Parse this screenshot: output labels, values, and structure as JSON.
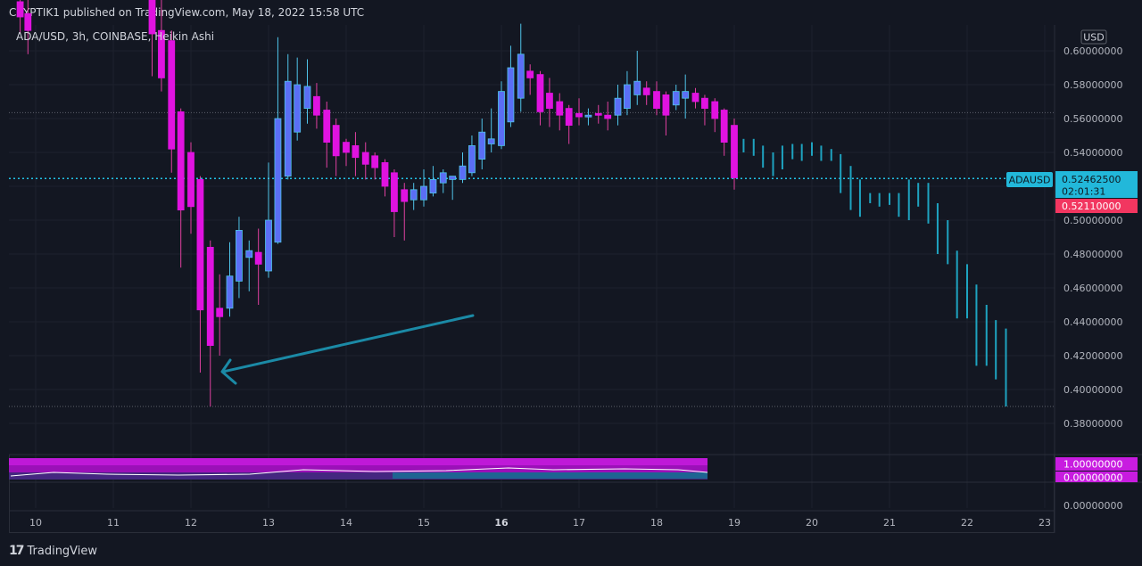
{
  "header": {
    "published": "CRYPTIK1 published on TradingView.com, May 18, 2022 15:58 UTC",
    "legend": "ADA/USD, 3h, COINBASE, Heikin Ashi"
  },
  "axis": {
    "currency": "USD",
    "price_ticks": [
      "0.60000000",
      "0.58000000",
      "0.56000000",
      "0.54000000",
      "0.52000000",
      "0.50000000",
      "0.48000000",
      "0.46000000",
      "0.44000000",
      "0.42000000",
      "0.40000000",
      "0.38000000"
    ],
    "osc_ticks": [
      "1.00000000",
      "0.00000000"
    ],
    "zero_tick": "0.00000000",
    "x_ticks": [
      "10",
      "11",
      "12",
      "13",
      "14",
      "15",
      "16",
      "17",
      "18",
      "19",
      "20",
      "21",
      "22",
      "23"
    ]
  },
  "tags": {
    "symbol": "ADAUSD",
    "last_price": "0.52462500",
    "countdown": "02:01:31",
    "second_price": "0.52110000"
  },
  "colors": {
    "background": "#131722",
    "bull": "#5b6ef5",
    "bear": "#e013e0",
    "projection": "#1ea3c0",
    "last_price_line": "#22c3e6",
    "second_tag": "#f23660"
  },
  "brand": {
    "label": "TradingView",
    "logo": "tradingview-logo-icon"
  },
  "chart_data": {
    "type": "candlestick",
    "style": "Heikin Ashi",
    "symbol": "ADA/USD",
    "interval": "3h",
    "exchange": "COINBASE",
    "ylim": [
      0.37,
      0.63
    ],
    "last_price": 0.524625,
    "dotted_levels": [
      0.5635,
      0.39
    ],
    "candles": [
      {
        "x": 9.8,
        "o": 0.629,
        "c": 0.62,
        "h": 0.634,
        "l": 0.61
      },
      {
        "x": 9.9,
        "o": 0.622,
        "c": 0.612,
        "h": 0.63,
        "l": 0.598
      },
      {
        "x": 11.5,
        "o": 0.635,
        "c": 0.61,
        "h": 0.642,
        "l": 0.585
      },
      {
        "x": 11.62,
        "o": 0.612,
        "c": 0.584,
        "h": 0.63,
        "l": 0.576
      },
      {
        "x": 11.75,
        "o": 0.606,
        "c": 0.542,
        "h": 0.612,
        "l": 0.528
      },
      {
        "x": 11.87,
        "o": 0.564,
        "c": 0.506,
        "h": 0.566,
        "l": 0.472
      },
      {
        "x": 12.0,
        "o": 0.54,
        "c": 0.508,
        "h": 0.546,
        "l": 0.492
      },
      {
        "x": 12.12,
        "o": 0.524,
        "c": 0.447,
        "h": 0.526,
        "l": 0.41
      },
      {
        "x": 12.25,
        "o": 0.484,
        "c": 0.426,
        "h": 0.488,
        "l": 0.39
      },
      {
        "x": 12.37,
        "o": 0.448,
        "c": 0.443,
        "h": 0.468,
        "l": 0.42
      },
      {
        "x": 12.5,
        "o": 0.448,
        "c": 0.467,
        "h": 0.487,
        "l": 0.443
      },
      {
        "x": 12.62,
        "o": 0.464,
        "c": 0.494,
        "h": 0.502,
        "l": 0.454
      },
      {
        "x": 12.75,
        "o": 0.478,
        "c": 0.482,
        "h": 0.488,
        "l": 0.458
      },
      {
        "x": 12.87,
        "o": 0.481,
        "c": 0.474,
        "h": 0.495,
        "l": 0.45
      },
      {
        "x": 13.0,
        "o": 0.47,
        "c": 0.5,
        "h": 0.534,
        "l": 0.466
      },
      {
        "x": 13.12,
        "o": 0.487,
        "c": 0.56,
        "h": 0.608,
        "l": 0.486
      },
      {
        "x": 13.25,
        "o": 0.526,
        "c": 0.582,
        "h": 0.598,
        "l": 0.524
      },
      {
        "x": 13.37,
        "o": 0.552,
        "c": 0.58,
        "h": 0.596,
        "l": 0.547
      },
      {
        "x": 13.5,
        "o": 0.566,
        "c": 0.579,
        "h": 0.595,
        "l": 0.557
      },
      {
        "x": 13.62,
        "o": 0.573,
        "c": 0.562,
        "h": 0.581,
        "l": 0.554
      },
      {
        "x": 13.75,
        "o": 0.565,
        "c": 0.546,
        "h": 0.57,
        "l": 0.531
      },
      {
        "x": 13.87,
        "o": 0.556,
        "c": 0.538,
        "h": 0.56,
        "l": 0.526
      },
      {
        "x": 14.0,
        "o": 0.546,
        "c": 0.54,
        "h": 0.548,
        "l": 0.532
      },
      {
        "x": 14.12,
        "o": 0.544,
        "c": 0.537,
        "h": 0.552,
        "l": 0.526
      },
      {
        "x": 14.25,
        "o": 0.54,
        "c": 0.533,
        "h": 0.546,
        "l": 0.524
      },
      {
        "x": 14.37,
        "o": 0.538,
        "c": 0.531,
        "h": 0.54,
        "l": 0.524
      },
      {
        "x": 14.5,
        "o": 0.534,
        "c": 0.52,
        "h": 0.536,
        "l": 0.514
      },
      {
        "x": 14.62,
        "o": 0.528,
        "c": 0.505,
        "h": 0.53,
        "l": 0.49
      },
      {
        "x": 14.75,
        "o": 0.518,
        "c": 0.511,
        "h": 0.522,
        "l": 0.488
      },
      {
        "x": 14.87,
        "o": 0.512,
        "c": 0.518,
        "h": 0.522,
        "l": 0.506
      },
      {
        "x": 15.0,
        "o": 0.512,
        "c": 0.52,
        "h": 0.53,
        "l": 0.508
      },
      {
        "x": 15.12,
        "o": 0.516,
        "c": 0.524,
        "h": 0.532,
        "l": 0.514
      },
      {
        "x": 15.25,
        "o": 0.522,
        "c": 0.528,
        "h": 0.53,
        "l": 0.516
      },
      {
        "x": 15.37,
        "o": 0.524,
        "c": 0.526,
        "h": 0.526,
        "l": 0.512
      },
      {
        "x": 15.5,
        "o": 0.524,
        "c": 0.532,
        "h": 0.54,
        "l": 0.522
      },
      {
        "x": 15.62,
        "o": 0.528,
        "c": 0.544,
        "h": 0.55,
        "l": 0.526
      },
      {
        "x": 15.75,
        "o": 0.536,
        "c": 0.552,
        "h": 0.56,
        "l": 0.53
      },
      {
        "x": 15.87,
        "o": 0.545,
        "c": 0.548,
        "h": 0.566,
        "l": 0.54
      },
      {
        "x": 16.0,
        "o": 0.544,
        "c": 0.576,
        "h": 0.582,
        "l": 0.542
      },
      {
        "x": 16.12,
        "o": 0.558,
        "c": 0.59,
        "h": 0.603,
        "l": 0.555
      },
      {
        "x": 16.25,
        "o": 0.572,
        "c": 0.598,
        "h": 0.616,
        "l": 0.564
      },
      {
        "x": 16.37,
        "o": 0.588,
        "c": 0.584,
        "h": 0.592,
        "l": 0.574
      },
      {
        "x": 16.5,
        "o": 0.586,
        "c": 0.564,
        "h": 0.588,
        "l": 0.556
      },
      {
        "x": 16.62,
        "o": 0.575,
        "c": 0.566,
        "h": 0.584,
        "l": 0.555
      },
      {
        "x": 16.75,
        "o": 0.57,
        "c": 0.562,
        "h": 0.575,
        "l": 0.553
      },
      {
        "x": 16.87,
        "o": 0.566,
        "c": 0.556,
        "h": 0.568,
        "l": 0.545
      },
      {
        "x": 17.0,
        "o": 0.563,
        "c": 0.561,
        "h": 0.572,
        "l": 0.556
      },
      {
        "x": 17.12,
        "o": 0.561,
        "c": 0.562,
        "h": 0.566,
        "l": 0.556
      },
      {
        "x": 17.25,
        "o": 0.563,
        "c": 0.562,
        "h": 0.568,
        "l": 0.557
      },
      {
        "x": 17.37,
        "o": 0.562,
        "c": 0.56,
        "h": 0.57,
        "l": 0.553
      },
      {
        "x": 17.5,
        "o": 0.562,
        "c": 0.572,
        "h": 0.58,
        "l": 0.556
      },
      {
        "x": 17.62,
        "o": 0.566,
        "c": 0.58,
        "h": 0.588,
        "l": 0.562
      },
      {
        "x": 17.75,
        "o": 0.574,
        "c": 0.582,
        "h": 0.6,
        "l": 0.568
      },
      {
        "x": 17.87,
        "o": 0.578,
        "c": 0.574,
        "h": 0.582,
        "l": 0.568
      },
      {
        "x": 18.0,
        "o": 0.576,
        "c": 0.566,
        "h": 0.582,
        "l": 0.562
      },
      {
        "x": 18.12,
        "o": 0.574,
        "c": 0.562,
        "h": 0.576,
        "l": 0.55
      },
      {
        "x": 18.25,
        "o": 0.568,
        "c": 0.576,
        "h": 0.58,
        "l": 0.565
      },
      {
        "x": 18.37,
        "o": 0.572,
        "c": 0.576,
        "h": 0.586,
        "l": 0.56
      },
      {
        "x": 18.5,
        "o": 0.575,
        "c": 0.57,
        "h": 0.578,
        "l": 0.566
      },
      {
        "x": 18.62,
        "o": 0.572,
        "c": 0.566,
        "h": 0.574,
        "l": 0.556
      },
      {
        "x": 18.75,
        "o": 0.57,
        "c": 0.56,
        "h": 0.572,
        "l": 0.552
      },
      {
        "x": 18.87,
        "o": 0.565,
        "c": 0.546,
        "h": 0.566,
        "l": 0.538
      },
      {
        "x": 19.0,
        "o": 0.556,
        "c": 0.525,
        "h": 0.56,
        "l": 0.518
      }
    ],
    "projection": [
      {
        "x": 19.12,
        "h": 0.548,
        "l": 0.54
      },
      {
        "x": 19.25,
        "h": 0.548,
        "l": 0.538
      },
      {
        "x": 19.37,
        "h": 0.544,
        "l": 0.531
      },
      {
        "x": 19.5,
        "h": 0.54,
        "l": 0.526
      },
      {
        "x": 19.62,
        "h": 0.544,
        "l": 0.53
      },
      {
        "x": 19.75,
        "h": 0.545,
        "l": 0.536
      },
      {
        "x": 19.87,
        "h": 0.545,
        "l": 0.535
      },
      {
        "x": 20.0,
        "h": 0.546,
        "l": 0.538
      },
      {
        "x": 20.12,
        "h": 0.544,
        "l": 0.535
      },
      {
        "x": 20.25,
        "h": 0.542,
        "l": 0.535
      },
      {
        "x": 20.37,
        "h": 0.539,
        "l": 0.516
      },
      {
        "x": 20.5,
        "h": 0.532,
        "l": 0.506
      },
      {
        "x": 20.62,
        "h": 0.524,
        "l": 0.502
      },
      {
        "x": 20.75,
        "h": 0.516,
        "l": 0.51
      },
      {
        "x": 20.87,
        "h": 0.516,
        "l": 0.508
      },
      {
        "x": 21.0,
        "h": 0.516,
        "l": 0.509
      },
      {
        "x": 21.12,
        "h": 0.516,
        "l": 0.502
      },
      {
        "x": 21.25,
        "h": 0.524,
        "l": 0.5
      },
      {
        "x": 21.37,
        "h": 0.522,
        "l": 0.508
      },
      {
        "x": 21.5,
        "h": 0.522,
        "l": 0.498
      },
      {
        "x": 21.62,
        "h": 0.51,
        "l": 0.48
      },
      {
        "x": 21.75,
        "h": 0.5,
        "l": 0.474
      },
      {
        "x": 21.87,
        "h": 0.482,
        "l": 0.442
      },
      {
        "x": 22.0,
        "h": 0.474,
        "l": 0.442
      },
      {
        "x": 22.12,
        "h": 0.462,
        "l": 0.414
      },
      {
        "x": 22.25,
        "h": 0.45,
        "l": 0.414
      },
      {
        "x": 22.37,
        "h": 0.441,
        "l": 0.406
      },
      {
        "x": 22.5,
        "h": 0.436,
        "l": 0.39
      }
    ],
    "oscillator": {
      "ylim": [
        0,
        1
      ],
      "ticks": [
        1.0,
        0.0
      ]
    }
  }
}
